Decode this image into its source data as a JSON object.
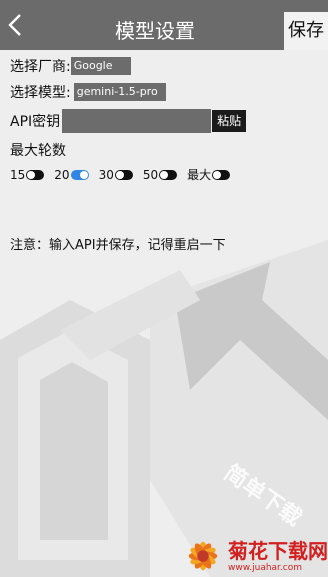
{
  "header": {
    "title": "模型设置",
    "save_label": "保存",
    "back_icon": "chevron-left-icon"
  },
  "form": {
    "vendor_label": "选择厂商:",
    "vendor_value": "Google",
    "model_label": "选择模型:",
    "model_value": "gemini-1.5-pro",
    "api_label": "API密钥",
    "api_value": "",
    "paste_label": "粘贴",
    "max_turns_label": "最大轮数",
    "turn_options": [
      {
        "label": "15",
        "on": false
      },
      {
        "label": "20",
        "on": true
      },
      {
        "label": "30",
        "on": false
      },
      {
        "label": "50",
        "on": false
      },
      {
        "label": "最大",
        "on": false
      }
    ]
  },
  "note": "注意：输入API并保存，记得重启一下",
  "watermark": {
    "diagonal_text": "简单下载",
    "logo_text": "菊花下载网",
    "logo_url": "www.juahar.com"
  },
  "colors": {
    "header_bg": "#6b6b6b",
    "field_bg": "#6c6c6c",
    "toggle_on": "#2f86e6",
    "brand_red": "#d21f1f"
  }
}
